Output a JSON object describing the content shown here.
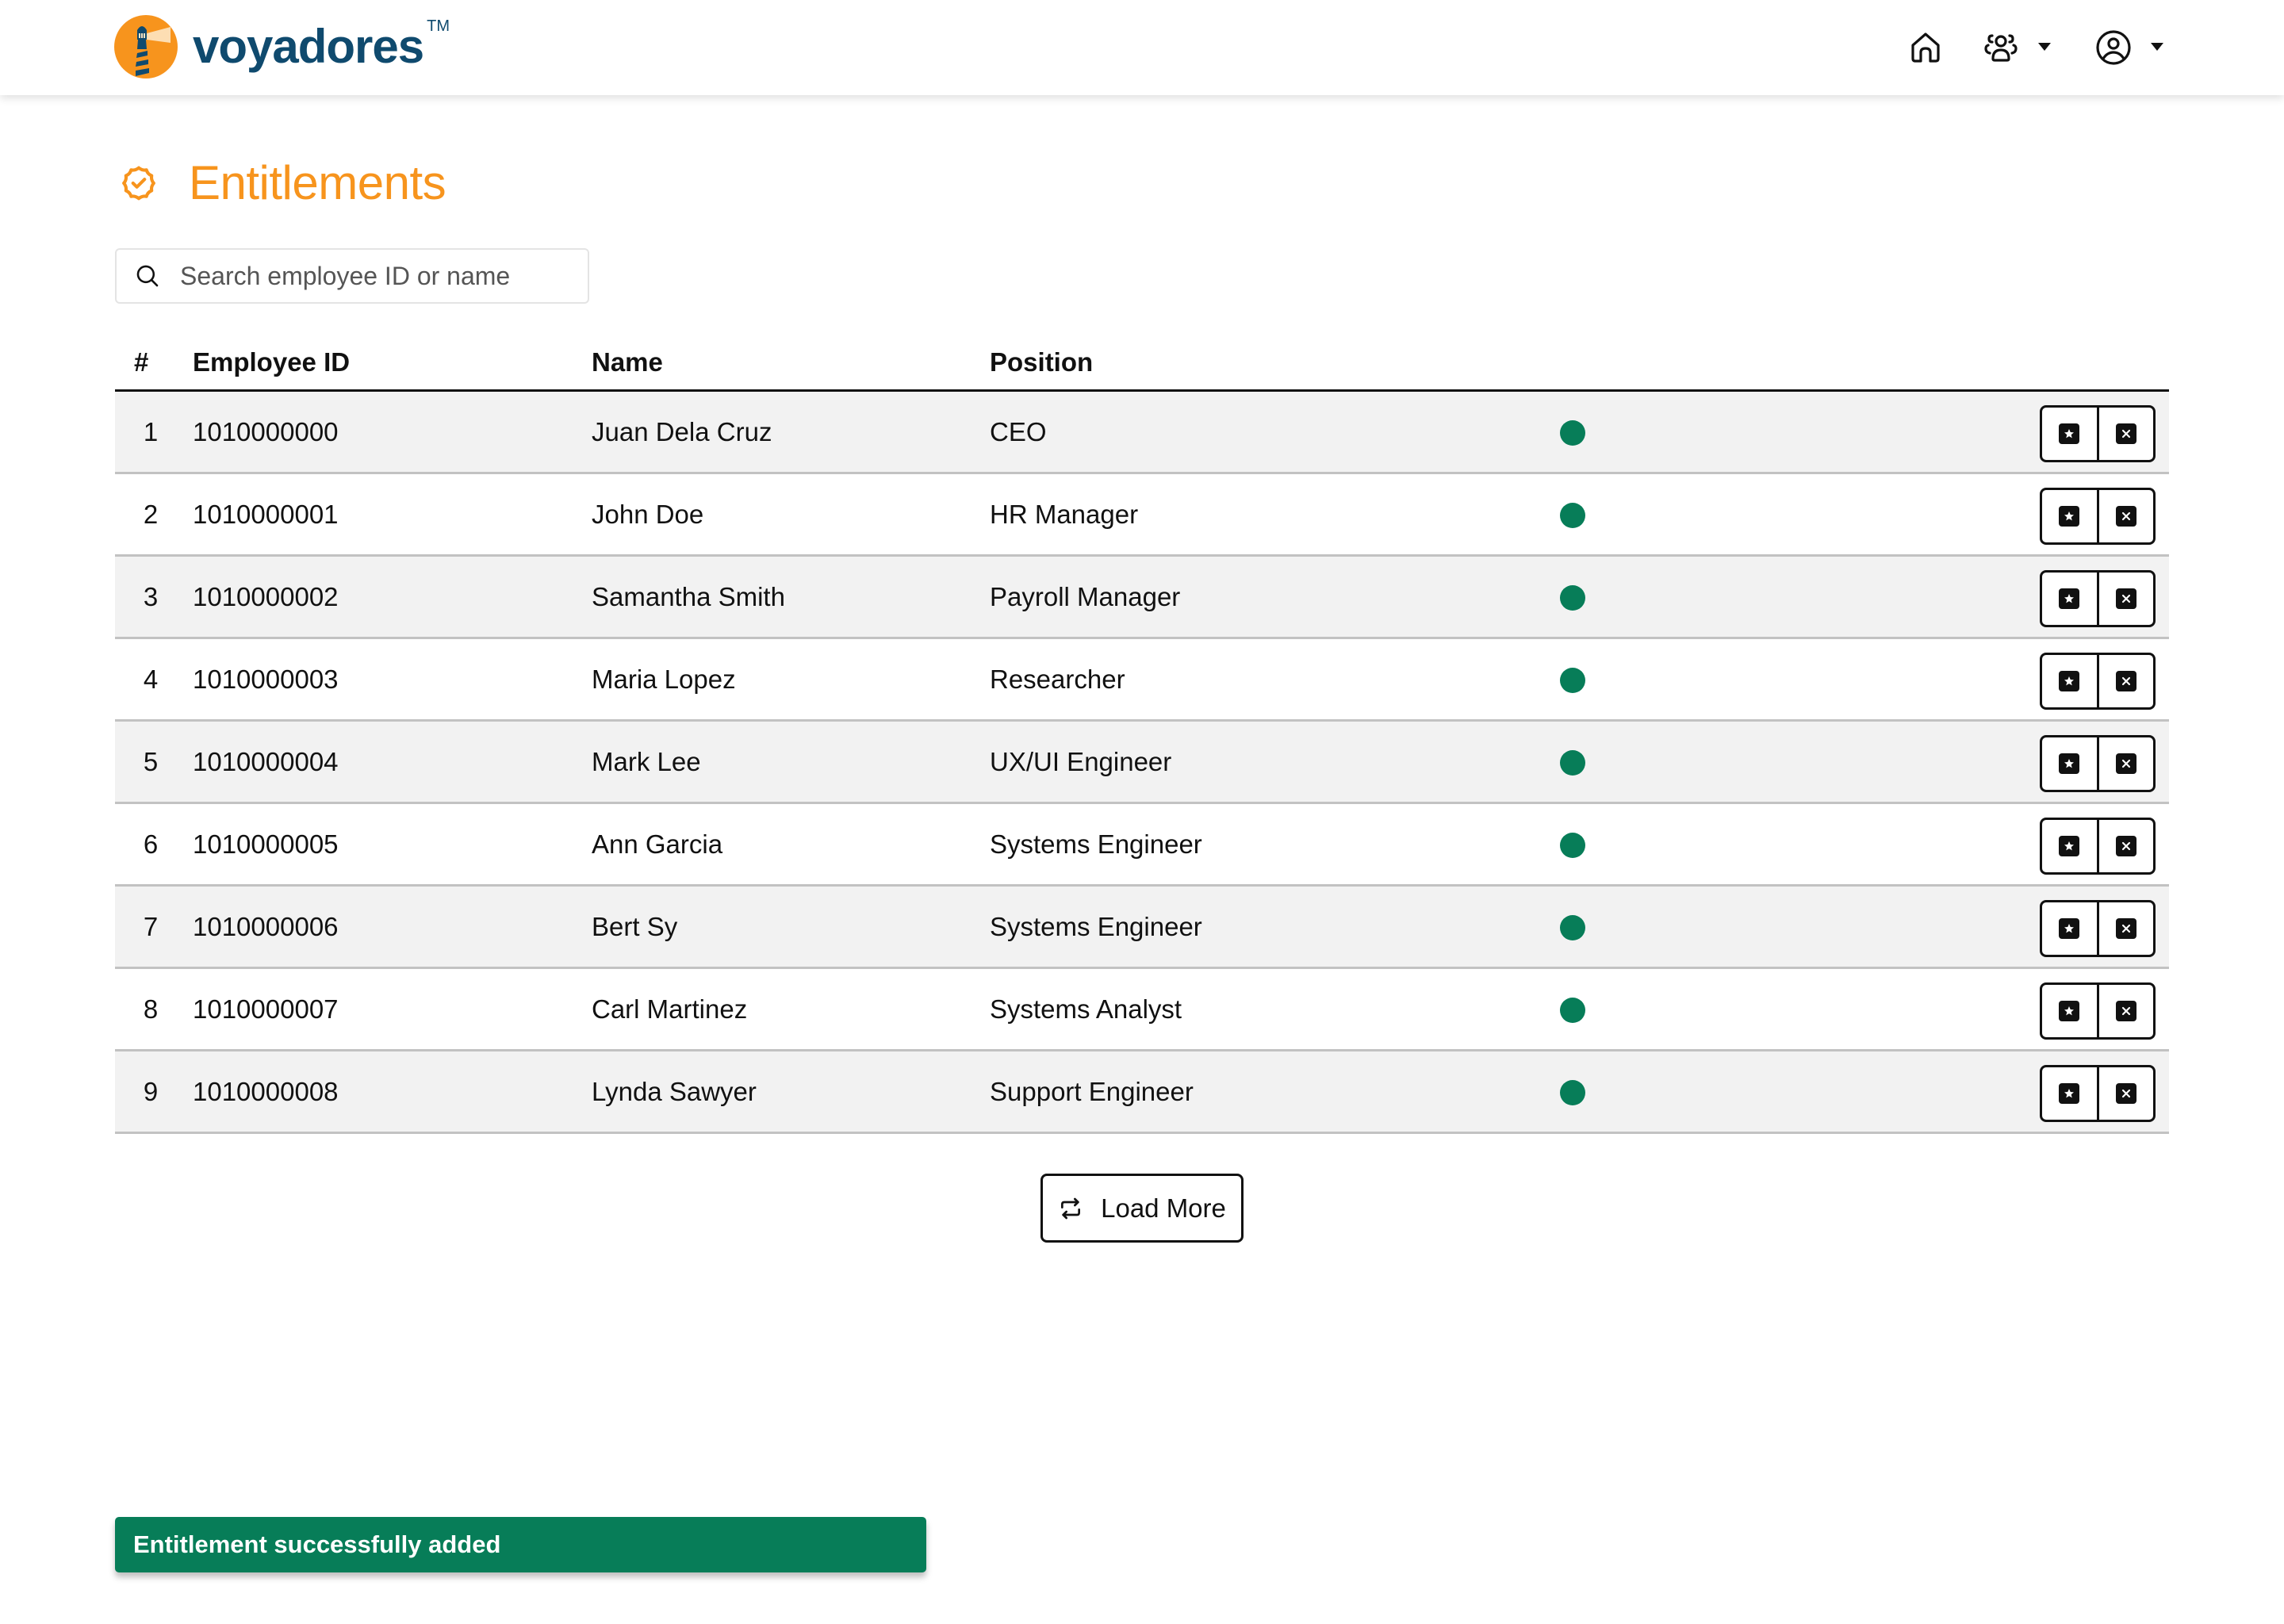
{
  "header": {
    "brand": "voyadores",
    "trademark": "TM",
    "nav": {
      "home_icon": "home-icon",
      "team_icon": "users-icon",
      "account_icon": "user-circle-icon"
    }
  },
  "page": {
    "title": "Entitlements",
    "title_icon": "badge-check-icon"
  },
  "search": {
    "placeholder": "Search employee ID or name",
    "value": ""
  },
  "table": {
    "columns": [
      "#",
      "Employee ID",
      "Name",
      "Position"
    ],
    "rows": [
      {
        "num": "1",
        "id": "1010000000",
        "name": "Juan Dela Cruz",
        "position": "CEO",
        "status": "active"
      },
      {
        "num": "2",
        "id": "1010000001",
        "name": "John Doe",
        "position": "HR Manager",
        "status": "active"
      },
      {
        "num": "3",
        "id": "1010000002",
        "name": "Samantha Smith",
        "position": "Payroll Manager",
        "status": "active"
      },
      {
        "num": "4",
        "id": "1010000003",
        "name": "Maria Lopez",
        "position": "Researcher",
        "status": "active"
      },
      {
        "num": "5",
        "id": "1010000004",
        "name": "Mark Lee",
        "position": "UX/UI Engineer",
        "status": "active"
      },
      {
        "num": "6",
        "id": "1010000005",
        "name": "Ann Garcia",
        "position": "Systems Engineer",
        "status": "active"
      },
      {
        "num": "7",
        "id": "1010000006",
        "name": "Bert Sy",
        "position": "Systems Engineer",
        "status": "active"
      },
      {
        "num": "8",
        "id": "1010000007",
        "name": "Carl Martinez",
        "position": "Systems Analyst",
        "status": "active"
      },
      {
        "num": "9",
        "id": "1010000008",
        "name": "Lynda Sawyer",
        "position": "Support Engineer",
        "status": "active"
      }
    ],
    "row_actions": [
      "star-icon",
      "close-icon"
    ]
  },
  "load_more": {
    "label": "Load More",
    "icon": "repeat-icon"
  },
  "toast": {
    "message": "Entitlement successfully added"
  },
  "colors": {
    "brand_orange": "#f7941d",
    "brand_navy": "#0f4a6e",
    "status_active": "#077d58",
    "toast_bg": "#077d58",
    "row_alt_bg": "#f2f2f2"
  }
}
